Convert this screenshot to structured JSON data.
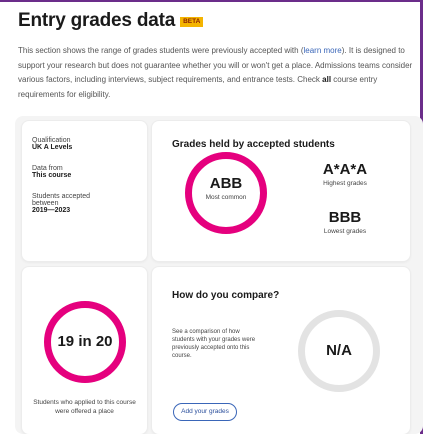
{
  "header": {
    "title": "Entry grades data",
    "badge": "BETA"
  },
  "intro": {
    "text_1": "This section shows the range of grades students were previously accepted with (",
    "link": "learn more",
    "text_2": "). It is designed to support your research but does not guarantee whether you will or won't get a place. Admissions teams consider various factors, including interviews, subject requirements, and entrance tests. Check ",
    "bold": "all",
    "text_3": " course entry requirements for eligibility."
  },
  "qualification_card": {
    "qualification_label": "Qualification",
    "qualification_value": "UK A Levels",
    "data_from_label": "Data from",
    "data_from_value": "This course",
    "accepted_label": "Students accepted between",
    "accepted_value": "2019—2023"
  },
  "grades_card": {
    "title": "Grades held by accepted students",
    "common_grade": "ABB",
    "common_label": "Most common",
    "highest_grade": "A*A*A",
    "highest_label": "Highest grades",
    "lowest_grade": "BBB",
    "lowest_label": "Lowest grades"
  },
  "ratio_card": {
    "ratio": "19 in 20",
    "caption": "Students who applied to this course were offered a place"
  },
  "compare_card": {
    "title": "How do you compare?",
    "description": "See a comparison of how students with your grades were previously accepted onto this course.",
    "value": "N/A",
    "button_label": "Add your grades"
  },
  "colors": {
    "accent_ring": "#e5007e",
    "neutral_ring": "#e3e3e3",
    "beta_badge": "#f4b400",
    "border": "#6b2d8a",
    "link": "#3a66b8"
  },
  "icons": []
}
